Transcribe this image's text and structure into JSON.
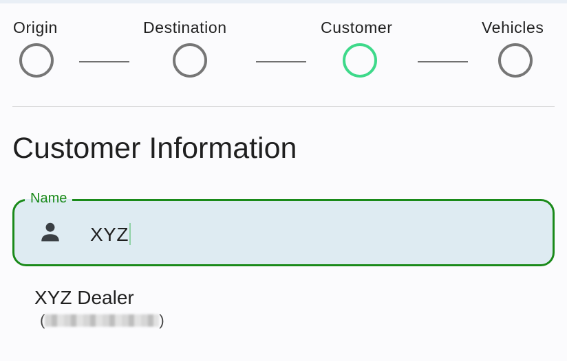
{
  "stepper": {
    "steps": [
      {
        "label": "Origin",
        "state": "incomplete"
      },
      {
        "label": "Destination",
        "state": "incomplete"
      },
      {
        "label": "Customer",
        "state": "active"
      },
      {
        "label": "Vehicles",
        "state": "incomplete"
      }
    ],
    "colors": {
      "active": "#3ed98a",
      "inactive": "#767676"
    }
  },
  "section": {
    "title": "Customer Information"
  },
  "name_field": {
    "label": "Name",
    "value": "XYZ",
    "icon": "person-icon",
    "colors": {
      "border": "#1a8a1a",
      "background": "#deebf2"
    }
  },
  "suggestions": [
    {
      "name": "XYZ Dealer",
      "sub_open": "(",
      "sub_close": ")",
      "sub_redacted": true
    }
  ]
}
